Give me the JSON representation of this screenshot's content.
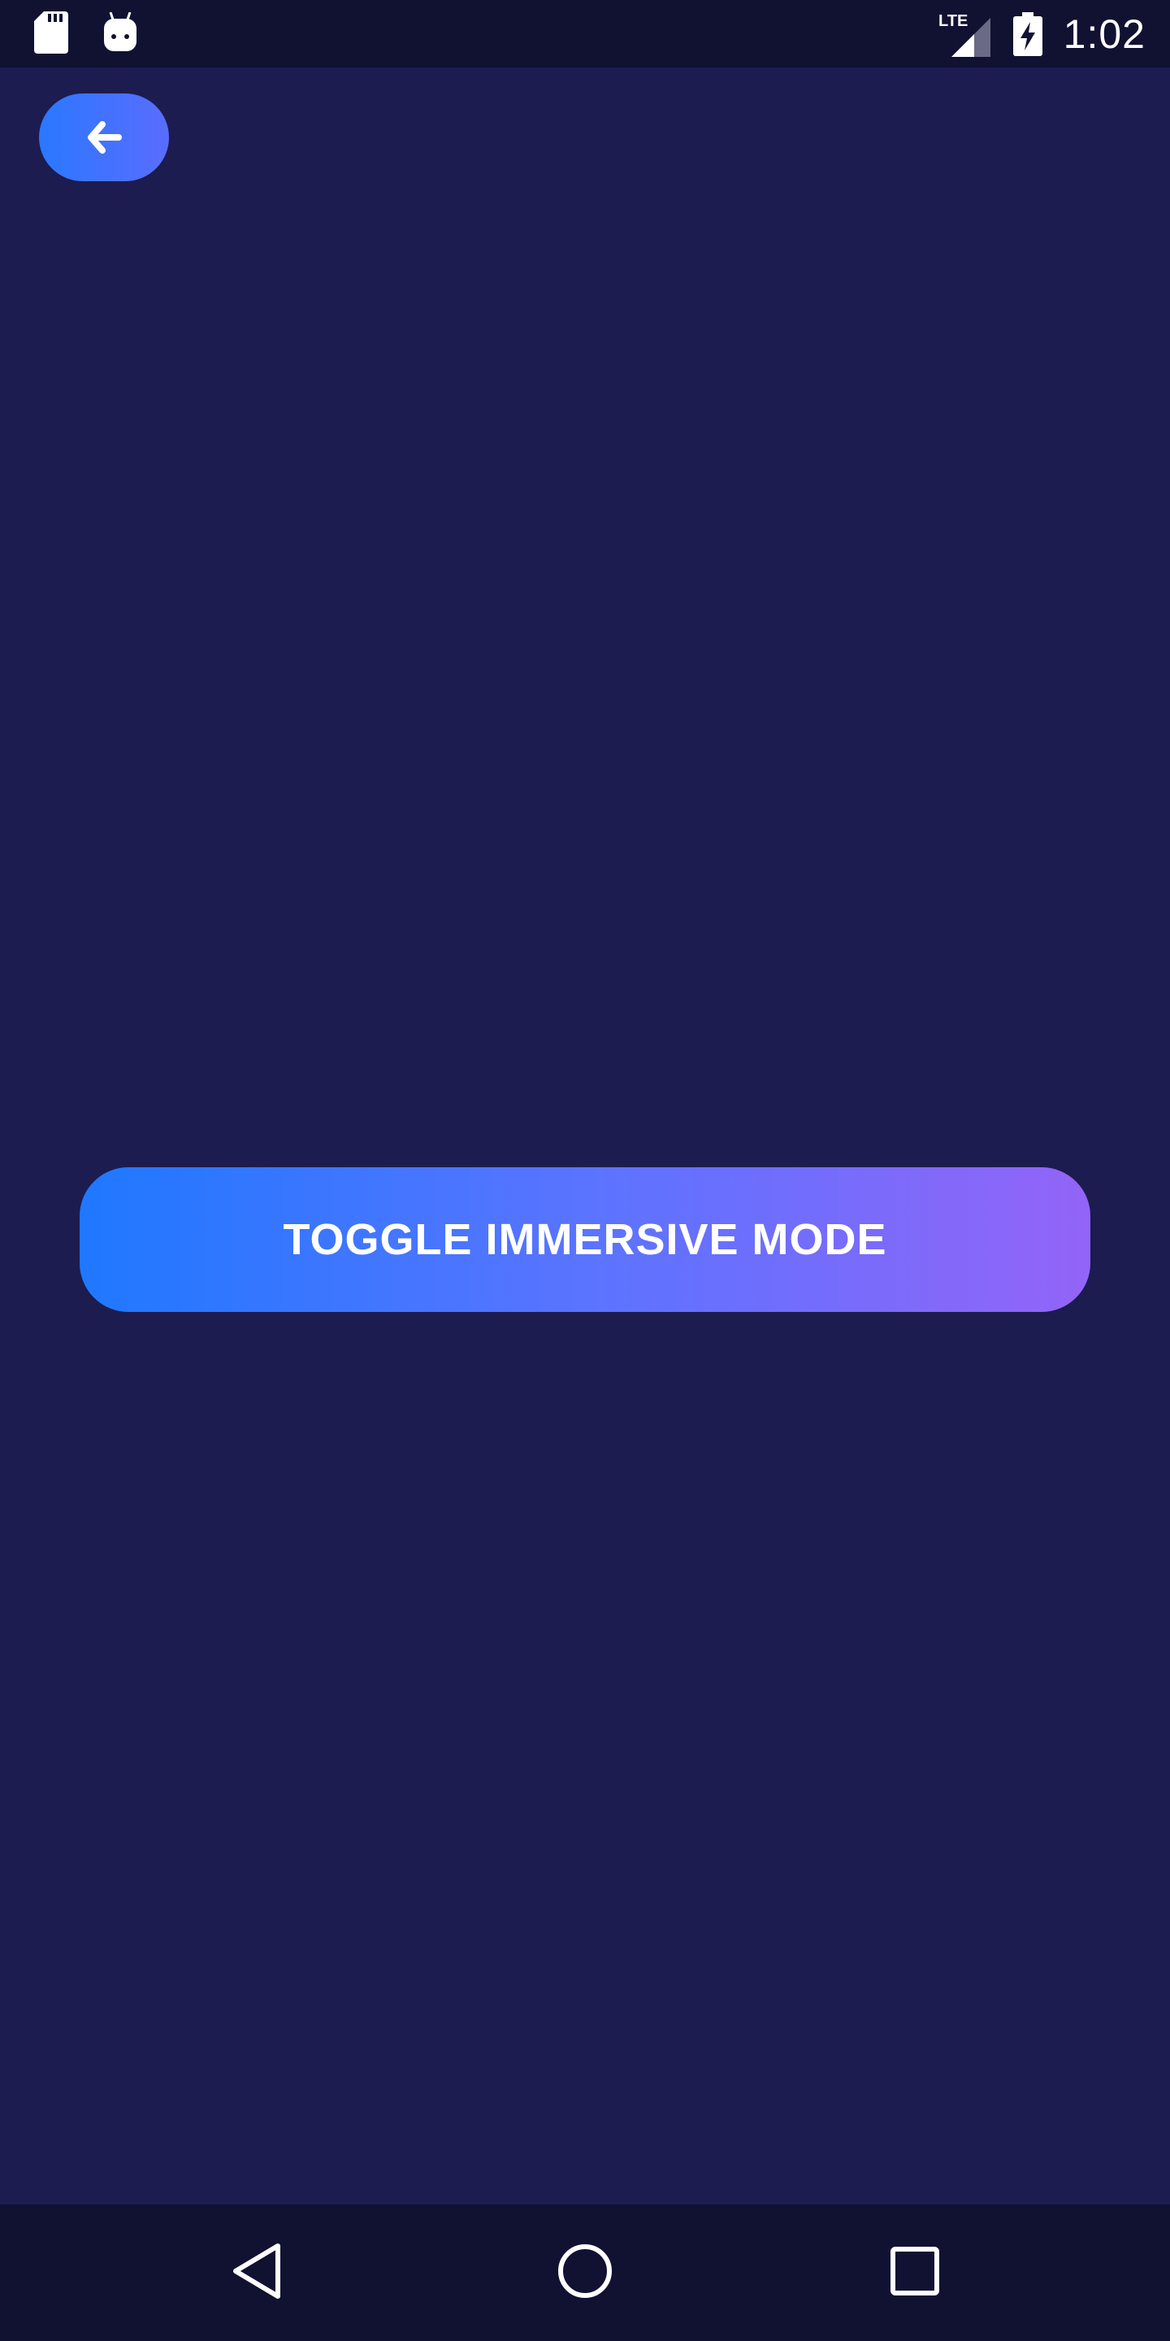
{
  "status_bar": {
    "time": "1:02",
    "network_label": "LTE",
    "left_icons": [
      "sd-card-icon",
      "android-debug-icon"
    ],
    "right_icons": [
      "lte-signal-icon",
      "battery-charging-icon"
    ]
  },
  "back_button": {
    "icon": "arrow-left-icon"
  },
  "main": {
    "toggle_button_label": "TOGGLE IMMERSIVE MODE"
  },
  "nav_bar": {
    "buttons": [
      "nav-back-icon",
      "nav-home-icon",
      "nav-recents-icon"
    ]
  },
  "colors": {
    "background": "#1c1c50",
    "system_bars": "#111132",
    "gradient_start": "#1f78ff",
    "gradient_end": "#9364f8",
    "text": "#ffffff"
  }
}
